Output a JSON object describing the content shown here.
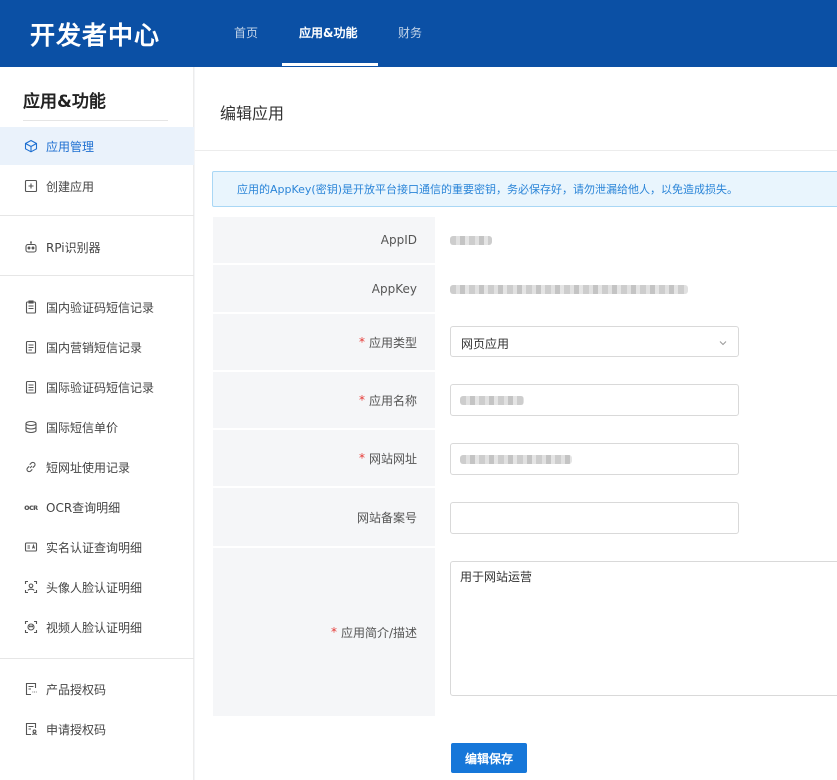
{
  "header": {
    "brand": "开发者中心",
    "nav": [
      {
        "label": "首页",
        "active": false
      },
      {
        "label": "应用&功能",
        "active": true
      },
      {
        "label": "财务",
        "active": false
      }
    ]
  },
  "sidebar": {
    "title": "应用&功能",
    "items": [
      {
        "label": "应用管理",
        "icon": "cube-icon",
        "active": true
      },
      {
        "label": "创建应用",
        "icon": "add-square-icon",
        "active": false
      },
      {
        "label": "RPi识别器",
        "icon": "robot-icon",
        "active": false
      },
      {
        "label": "国内验证码短信记录",
        "icon": "clipboard-icon",
        "active": false
      },
      {
        "label": "国内营销短信记录",
        "icon": "document-icon",
        "active": false
      },
      {
        "label": "国际验证码短信记录",
        "icon": "list-doc-icon",
        "active": false
      },
      {
        "label": "国际短信单价",
        "icon": "coins-icon",
        "active": false
      },
      {
        "label": "短网址使用记录",
        "icon": "link-icon",
        "active": false
      },
      {
        "label": "OCR查询明细",
        "icon": "ocr-icon",
        "active": false
      },
      {
        "label": "实名认证查询明细",
        "icon": "id-card-icon",
        "active": false
      },
      {
        "label": "头像人脸认证明细",
        "icon": "face-scan-icon",
        "active": false
      },
      {
        "label": "视频人脸认证明细",
        "icon": "video-face-icon",
        "active": false
      },
      {
        "label": "产品授权码",
        "icon": "license-icon",
        "active": false
      },
      {
        "label": "申请授权码",
        "icon": "apply-license-icon",
        "active": false
      }
    ]
  },
  "main": {
    "title": "编辑应用",
    "notice": "应用的AppKey(密钥)是开放平台接口通信的重要密钥，务必保存好，请勿泄漏给他人，以免造成损失。",
    "form": {
      "appid_label": "AppID",
      "appkey_label": "AppKey",
      "app_type_label": "应用类型",
      "app_type_value": "网页应用",
      "app_name_label": "应用名称",
      "website_label": "网站网址",
      "icp_label": "网站备案号",
      "icp_value": "",
      "desc_label": "应用简介/描述",
      "desc_value": "用于网站运营",
      "required_mark": "*"
    },
    "save_label": "编辑保存"
  },
  "colors": {
    "header_bg": "#0b50a5",
    "accent": "#1677d9",
    "active_bg": "#eaf2fb",
    "notice_bg": "#e9f5fd",
    "required": "#e53935"
  }
}
